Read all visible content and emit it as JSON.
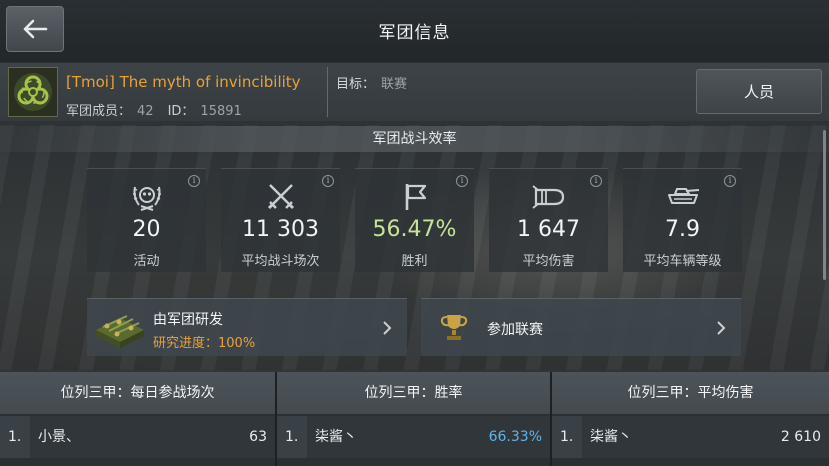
{
  "header": {
    "title": "军团信息",
    "back_icon": "arrow-left-icon"
  },
  "clan": {
    "emblem_icon": "biohazard-icon",
    "name": "[Tmoi] The myth of invincibility",
    "members_label": "军团成员：",
    "members_count": "42",
    "id_label": "ID：",
    "id_value": "15891",
    "goal_label": "目标：",
    "goal_value": "联赛",
    "members_button": "人员"
  },
  "efficiency": {
    "section_title": "军团战斗效率",
    "stats": [
      {
        "icon": "skull-wreath-icon",
        "value": "20",
        "label": "活动"
      },
      {
        "icon": "crossed-swords-icon",
        "value": "11 303",
        "label": "平均战斗场次"
      },
      {
        "icon": "flag-icon",
        "value": "56.47%",
        "label": "胜利"
      },
      {
        "icon": "shell-icon",
        "value": "1 647",
        "label": "平均伤害"
      },
      {
        "icon": "tank-icon",
        "value": "7.9",
        "label": "平均车辆等级"
      }
    ],
    "info_glyph": "i"
  },
  "actions": {
    "research": {
      "title": "由军团研发",
      "progress": "研究进度：100%",
      "icon": "supply-crate-icon"
    },
    "league": {
      "title": "参加联赛",
      "icon": "trophy-icon"
    }
  },
  "rankings": [
    {
      "title": "位列三甲：每日参战场次",
      "pos": "1.",
      "name": "小景、",
      "value": "63"
    },
    {
      "title": "位列三甲：胜率",
      "pos": "1.",
      "name": "柒酱丶",
      "value": "66.33%"
    },
    {
      "title": "位列三甲：平均伤害",
      "pos": "1.",
      "name": "柒酱丶",
      "value": "2 610"
    }
  ],
  "colors": {
    "accent_orange": "#e8a23a",
    "win_green": "#c7e39a",
    "rate_blue": "#5fb4ea"
  }
}
